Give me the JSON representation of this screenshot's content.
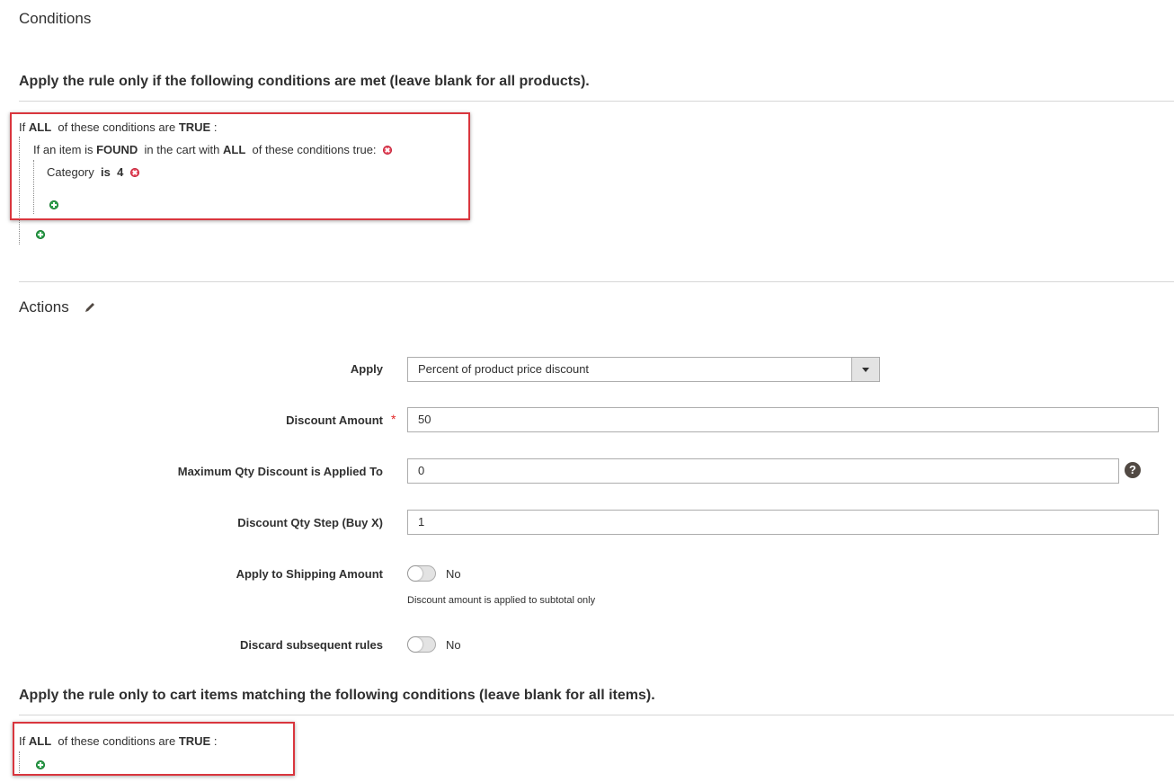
{
  "conditions_section": {
    "title": "Conditions",
    "subheading": "Apply the rule only if the following conditions are met (leave blank for all products).",
    "root": {
      "prefix": "If",
      "aggregator": "ALL",
      "middle": "of these conditions are",
      "value": "TRUE",
      "suffix": ":"
    },
    "found": {
      "prefix": "If an item is",
      "found_value": "FOUND",
      "middle": "in the cart with",
      "aggregator": "ALL",
      "suffix": "of these conditions true:"
    },
    "category": {
      "attribute": "Category",
      "operator": "is",
      "value": "4"
    }
  },
  "actions_section": {
    "title": "Actions",
    "fields": {
      "apply": {
        "label": "Apply",
        "value": "Percent of product price discount"
      },
      "discount_amount": {
        "label": "Discount Amount",
        "value": "50",
        "required_mark": "*"
      },
      "max_qty": {
        "label": "Maximum Qty Discount is Applied To",
        "value": "0",
        "help": "?"
      },
      "qty_step": {
        "label": "Discount Qty Step (Buy X)",
        "value": "1"
      },
      "apply_shipping": {
        "label": "Apply to Shipping Amount",
        "toggle_text": "No",
        "note": "Discount amount is applied to subtotal only"
      },
      "discard_rules": {
        "label": "Discard subsequent rules",
        "toggle_text": "No"
      }
    },
    "items_subheading": "Apply the rule only to cart items matching the following conditions (leave blank for all items).",
    "items_root": {
      "prefix": "If",
      "aggregator": "ALL",
      "middle": "of these conditions are",
      "value": "TRUE",
      "suffix": ":"
    }
  },
  "colors": {
    "highlight": "#d9363e",
    "add_icon": "#2fa34e",
    "delete_icon": "#e8485d",
    "required": "#e22626"
  }
}
